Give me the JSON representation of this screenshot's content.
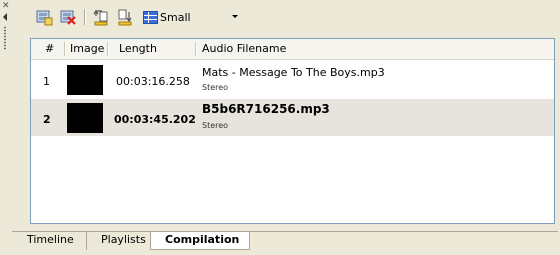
{
  "panel": {
    "close_glyph": "✕"
  },
  "toolbar": {
    "buttons": [
      {
        "icon": "add-image-icon"
      },
      {
        "icon": "remove-image-icon"
      },
      {
        "icon": "move-up-icon"
      },
      {
        "icon": "move-down-icon"
      }
    ],
    "size_label": "Small"
  },
  "grid": {
    "columns": [
      "#",
      "Image",
      "Length",
      "Audio Filename"
    ],
    "rows": [
      {
        "num": "1",
        "length": "00:03:16.258",
        "filename": "Mats - Message To The Boys.mp3",
        "channel": "Stereo",
        "selected": false
      },
      {
        "num": "2",
        "length": "00:03:45.202",
        "filename": "B5b6R716256.mp3",
        "channel": "Stereo",
        "selected": true
      }
    ]
  },
  "tabs": [
    "Timeline",
    "Playlists",
    "Compilation"
  ],
  "active_tab": "Compilation"
}
